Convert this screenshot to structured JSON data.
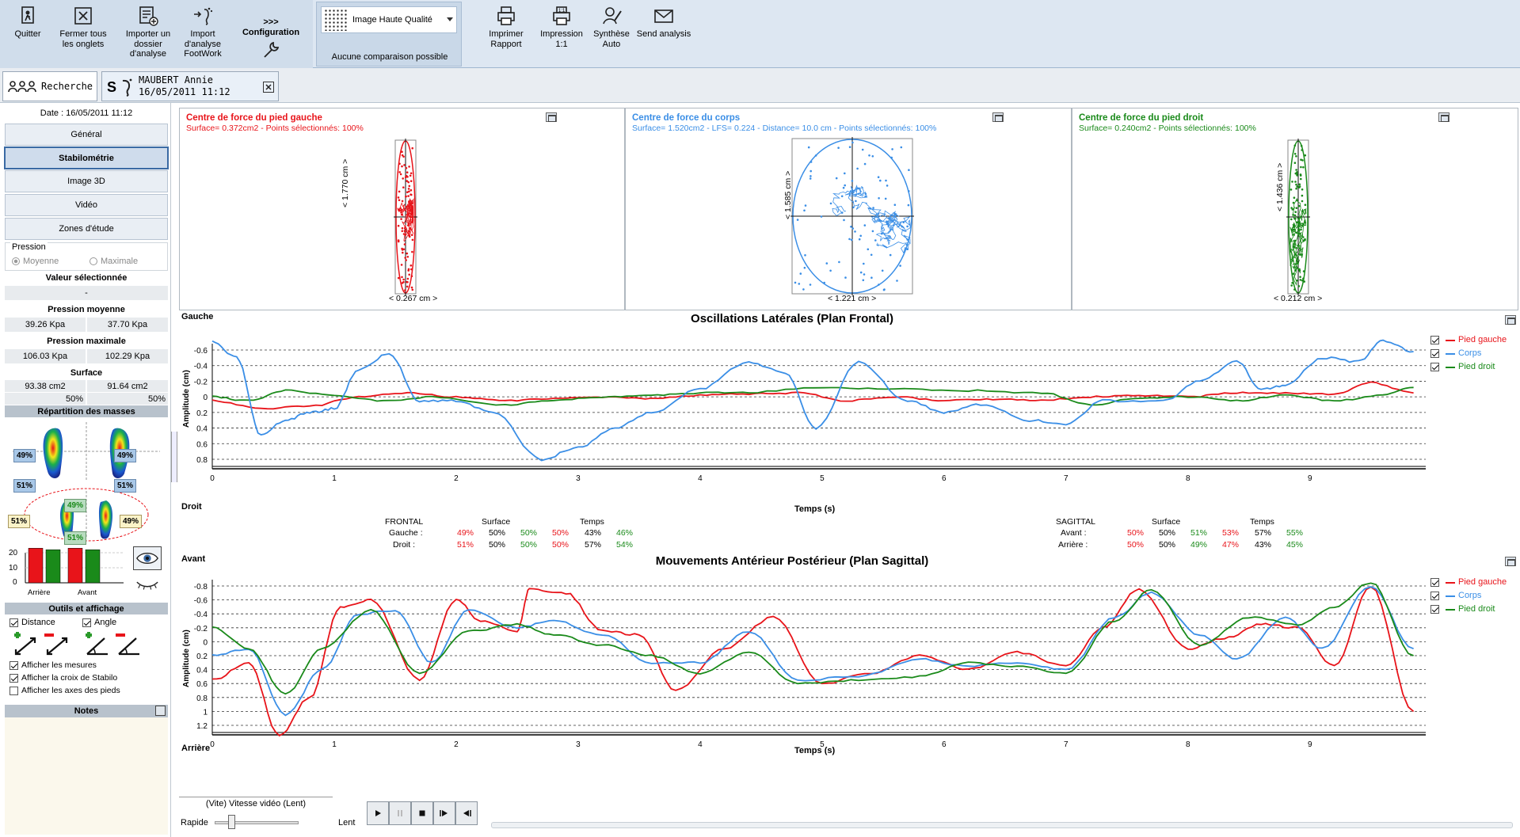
{
  "toolbar": {
    "quit": "Quitter",
    "close_tabs_l1": "Fermer tous",
    "close_tabs_l2": "les onglets",
    "import_folder_l1": "Importer un",
    "import_folder_l2": "dossier",
    "import_folder_l3": "d'analyse",
    "import_fw_l1": "Import",
    "import_fw_l2": "d'analyse",
    "import_fw_l3": "FootWork",
    "config_arrows": ">>>",
    "config": "Configuration",
    "quality_value": "Image Haute Qualité",
    "no_compare": "Aucune comparaison possible",
    "print_l1": "Imprimer",
    "print_l2": "Rapport",
    "print11_l1": "Impression",
    "print11_l2": "1:1",
    "synth_l1": "Synthèse",
    "synth_l2": "Auto",
    "send": "Send analysis"
  },
  "tabs": {
    "search": "Recherche",
    "patient_name": "MAUBERT Annie",
    "patient_date": "16/05/2011 11:12"
  },
  "sidebar": {
    "date": "Date : 16/05/2011 11:12",
    "nav": [
      "Général",
      "Stabilométrie",
      "Image 3D",
      "Vidéo",
      "Zones d'étude"
    ],
    "pression_label": "Pression",
    "moyenne": "Moyenne",
    "maximale": "Maximale",
    "val_sel_label": "Valeur sélectionnée",
    "val_sel": "-",
    "p_moy_label": "Pression moyenne",
    "p_moy_left": "39.26 Kpa",
    "p_moy_right": "37.70 Kpa",
    "p_max_label": "Pression maximale",
    "p_max_left": "106.03 Kpa",
    "p_max_right": "102.29 Kpa",
    "surface_label": "Surface",
    "surf_left": "93.38 cm2",
    "surf_right": "91.64 cm2",
    "surf_pct_left": "50%",
    "surf_pct_right": "50%",
    "repartition": "Répartition des masses",
    "mass_tl": "49%",
    "mass_tr": "49%",
    "mass_bl": "51%",
    "mass_br": "51%",
    "mass_top": "49%",
    "mass_left": "51%",
    "mass_right": "49%",
    "mass_bottom": "51%",
    "bars_ticks": [
      "20",
      "10",
      "0"
    ],
    "bars_xlabels": [
      "Arrière",
      "Avant"
    ],
    "bars_values": [
      23,
      22,
      23,
      22
    ],
    "outils": "Outils et affichage",
    "distance": "Distance",
    "angle": "Angle",
    "show_measures": "Afficher les mesures",
    "show_cross": "Afficher la croix de Stabilo",
    "show_axes": "Afficher les axes des pieds",
    "notes": "Notes"
  },
  "cop": {
    "left": {
      "title": "Centre de force du pied gauche",
      "sub": "Surface= 0.372cm2 - Points sélectionnés: 100%",
      "ylabel": "< 1.770 cm >",
      "xlabel": "< 0.267 cm >"
    },
    "body": {
      "title": "Centre de force du corps",
      "sub": "Surface= 1.520cm2 - LFS= 0.224 - Distance= 10.0 cm - Points sélectionnés: 100%",
      "ylabel": "< 1.585 cm >",
      "xlabel": "< 1.221 cm >"
    },
    "right": {
      "title": "Centre de force du pied droit",
      "sub": "Surface= 0.240cm2 - Points sélectionnés: 100%",
      "ylabel": "< 1.436 cm >",
      "xlabel": "< 0.212 cm >"
    }
  },
  "frontal": {
    "top_label": "Gauche",
    "bottom_label": "Droit",
    "title": "Oscillations Latérales (Plan Frontal)",
    "ylabel": "Amplitude (cm)",
    "xlabel": "Temps (s)",
    "yticks": [
      "-0.6",
      "-0.4",
      "-0.2",
      "0",
      "0.2",
      "0.4",
      "0.6",
      "0.8"
    ],
    "xticks": [
      "0",
      "1",
      "2",
      "3",
      "4",
      "5",
      "6",
      "7",
      "8",
      "9"
    ]
  },
  "sagittal": {
    "top_label": "Avant",
    "bottom_label": "Arrière",
    "title": "Mouvements Antérieur Postérieur (Plan Sagittal)",
    "ylabel": "Amplitude (cm)",
    "xlabel": "Temps (s)",
    "yticks": [
      "-0.8",
      "-0.6",
      "-0.4",
      "-0.2",
      "0",
      "0.2",
      "0.4",
      "0.6",
      "0.8",
      "1",
      "1.2"
    ],
    "xticks": [
      "0",
      "1",
      "2",
      "3",
      "4",
      "5",
      "6",
      "7",
      "8",
      "9"
    ]
  },
  "legend": {
    "pied_gauche": "Pied gauche",
    "corps": "Corps",
    "pied_droit": "Pied droit"
  },
  "stats": {
    "frontal_label": "FRONTAL",
    "surface": "Surface",
    "temps": "Temps",
    "gauche": "Gauche :",
    "droit": "Droit :",
    "g_vals": [
      "49%",
      "50%",
      "50%",
      "50%",
      "43%",
      "46%"
    ],
    "d_vals": [
      "51%",
      "50%",
      "50%",
      "50%",
      "57%",
      "54%"
    ],
    "sagittal_label": "SAGITTAL",
    "avant": "Avant :",
    "arriere": "Arrière :",
    "av_vals": [
      "50%",
      "50%",
      "51%",
      "53%",
      "57%",
      "55%"
    ],
    "ar_vals": [
      "50%",
      "50%",
      "49%",
      "47%",
      "43%",
      "45%"
    ]
  },
  "video": {
    "title": "(Vite)  Vitesse vidéo  (Lent)",
    "rapide": "Rapide",
    "lent": "Lent"
  },
  "colors": {
    "red": "#e8141a",
    "blue": "#3a8ee6",
    "green": "#1a8a1a"
  }
}
